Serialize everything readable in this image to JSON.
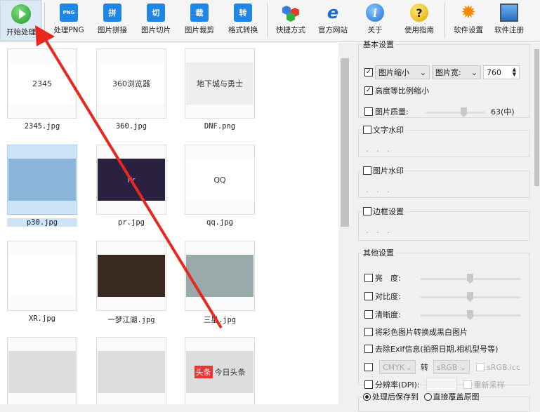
{
  "toolbar": {
    "start": "开始处理",
    "png": "处理PNG",
    "png_icon": "PNG",
    "stitch": "图片拼接",
    "stitch_icon": "拼",
    "slice": "图片切片",
    "slice_icon": "切",
    "crop": "图片裁剪",
    "crop_icon": "裁",
    "convert": "格式转换",
    "convert_icon": "转",
    "shortcut": "快捷方式",
    "website": "官方网站",
    "about": "关于",
    "guide": "使用指南",
    "settings": "软件设置",
    "register": "软件注册"
  },
  "files": [
    {
      "name": "2345.jpg",
      "thumb": "2345"
    },
    {
      "name": "360.jpg",
      "thumb": "360浏览器"
    },
    {
      "name": "DNF.png",
      "thumb": "地下城与勇士"
    },
    {
      "name": "p30.jpg",
      "selected": true
    },
    {
      "name": "pr.jpg",
      "thumb": "Pr"
    },
    {
      "name": "qq.jpg",
      "thumb": "QQ"
    },
    {
      "name": "XR.jpg"
    },
    {
      "name": "一梦江湖.jpg"
    },
    {
      "name": "三星.jpg"
    },
    {
      "name": ""
    },
    {
      "name": ""
    },
    {
      "name": "",
      "thumb": "今日头条",
      "badge": "头条"
    }
  ],
  "basic": {
    "title": "基本设置",
    "resize_label": "图片缩小",
    "resize_checked": true,
    "dim_label": "图片宽:",
    "width_value": "760",
    "keep_ratio": "高度等比例缩小",
    "keep_ratio_checked": true,
    "quality_label": "图片质量:",
    "quality_value": "63(中)",
    "quality": 63
  },
  "text_watermark": {
    "title": "文字水印",
    "dots": "· · ·"
  },
  "image_watermark": {
    "title": "图片水印",
    "dots": "· · ·"
  },
  "border": {
    "title": "边框设置",
    "dots": "· · ·"
  },
  "other": {
    "title": "其他设置",
    "brightness": "亮　度:",
    "contrast": "对比度:",
    "sharpness": "清晰度:",
    "grayscale": "将彩色图片转换成黑白图片",
    "exif": "去除Exif信息(拍照日期,相机型号等)",
    "from_cs": "CMYK",
    "to_label": "转",
    "to_cs": "sRGB",
    "icc": "sRGB.icc",
    "dpi": "分辨率(DPI):",
    "resample": "重新采样"
  },
  "output": {
    "save_to": "处理后保存到",
    "overwrite": "直接覆盖原图"
  }
}
